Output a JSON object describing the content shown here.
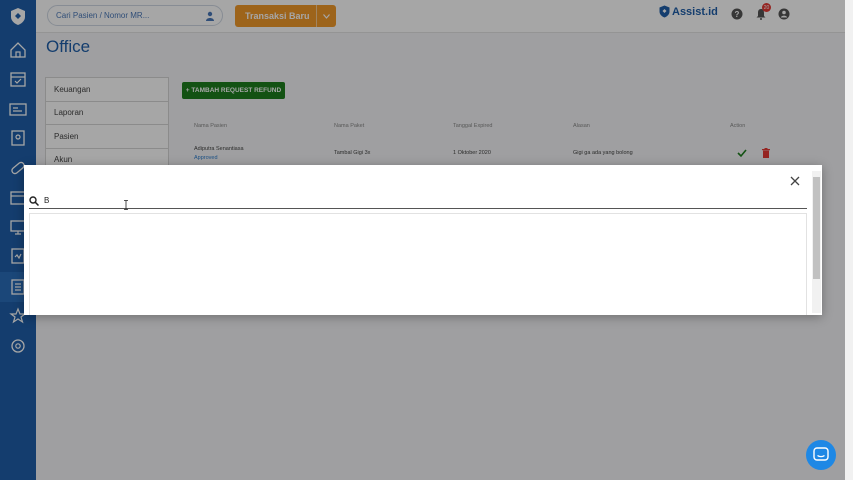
{
  "topbar": {
    "search_placeholder": "Cari Pasien / Nomor MR...",
    "transaction_button": "Transaksi Baru",
    "brand": "Assist.id",
    "notification_count": "20"
  },
  "page": {
    "title": "Office"
  },
  "menu": {
    "items": [
      {
        "label": "Keuangan"
      },
      {
        "label": "Laporan"
      },
      {
        "label": "Pasien"
      },
      {
        "label": "Akun"
      }
    ]
  },
  "content": {
    "add_button": "+ TAMBAH REQUEST REFUND",
    "columns": [
      "Nama Pasien",
      "Nama Paket",
      "Tanggal Expired",
      "Alasan",
      "Action"
    ],
    "row": {
      "patient": "Adiputra Senantiasa",
      "status": "Approved",
      "package": "Tambal Gigi 3x",
      "expired": "1 Oktober 2020",
      "reason": "Gigi ga ada yang bolong"
    }
  },
  "modal": {
    "search_value": "B"
  },
  "colors": {
    "primary": "#1f5fa9",
    "accent": "#f19a2a",
    "success": "#1e7e1e",
    "danger": "#e53935"
  }
}
